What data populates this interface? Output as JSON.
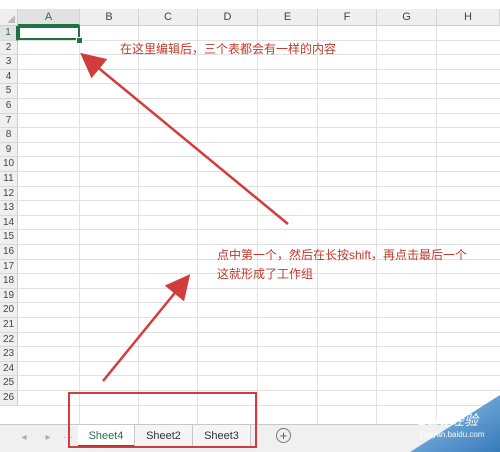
{
  "columns": [
    "A",
    "B",
    "C",
    "D",
    "E",
    "F",
    "G",
    "H"
  ],
  "rows": [
    "1",
    "2",
    "3",
    "4",
    "5",
    "6",
    "7",
    "8",
    "9",
    "10",
    "11",
    "12",
    "13",
    "14",
    "15",
    "16",
    "17",
    "18",
    "19",
    "20",
    "21",
    "22",
    "23",
    "24",
    "25",
    "26"
  ],
  "sheet_tabs": [
    {
      "label": "Sheet4",
      "active": true
    },
    {
      "label": "Sheet2",
      "active": false
    },
    {
      "label": "Sheet3",
      "active": false
    }
  ],
  "nav": {
    "prev": "◂",
    "next": "▸",
    "more": "…"
  },
  "add_sheet": "+",
  "annotations": {
    "top": "在这里编辑后，三个表都会有一样的内容",
    "middle_line1": "点中第一个，然后在长按shift，再点击最后一个",
    "middle_line2": "这就形成了工作组"
  },
  "watermark": {
    "brand": "Bai",
    "brand2": "经验",
    "sub": "jingyan.baidu.com"
  },
  "colors": {
    "accent": "#217346",
    "annotation": "#c0392b",
    "highlight_box": "#d33c3c"
  }
}
